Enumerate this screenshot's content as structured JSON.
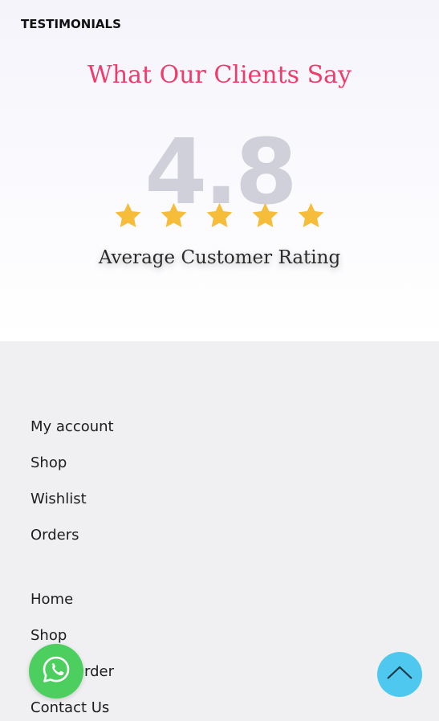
{
  "testimonials": {
    "eyebrow": "TESTIMONIALS",
    "heading": "What Our Clients Say",
    "rating_value": "4.8",
    "star_count": 5,
    "rating_label": "Average Customer Rating"
  },
  "footer": {
    "account_links": [
      "My account",
      "Shop",
      "Wishlist",
      "Orders"
    ],
    "nav_links": [
      "Home",
      "Shop",
      "Track Order",
      "Contact Us"
    ]
  },
  "floating": {
    "whatsapp_icon": "whatsapp-icon",
    "back_to_top_icon": "chevron-up-icon"
  },
  "colors": {
    "heading": "#ee3d6a",
    "star": "#f5bd3a",
    "rating_number": "#cfd0da",
    "whatsapp": "#4dcf5f",
    "back_to_top": "#4fc8f0"
  }
}
